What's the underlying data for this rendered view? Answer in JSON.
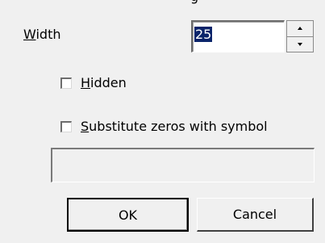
{
  "header_fragment": "g",
  "width": {
    "label_u": "W",
    "label_rest": "idth",
    "value": "25"
  },
  "hidden": {
    "label_u": "H",
    "label_rest": "idden",
    "checked": false
  },
  "substitute": {
    "label_u": "S",
    "label_rest": "ubstitute zeros with symbol",
    "checked": false,
    "symbol_value": ""
  },
  "buttons": {
    "ok": "OK",
    "cancel": "Cancel"
  }
}
